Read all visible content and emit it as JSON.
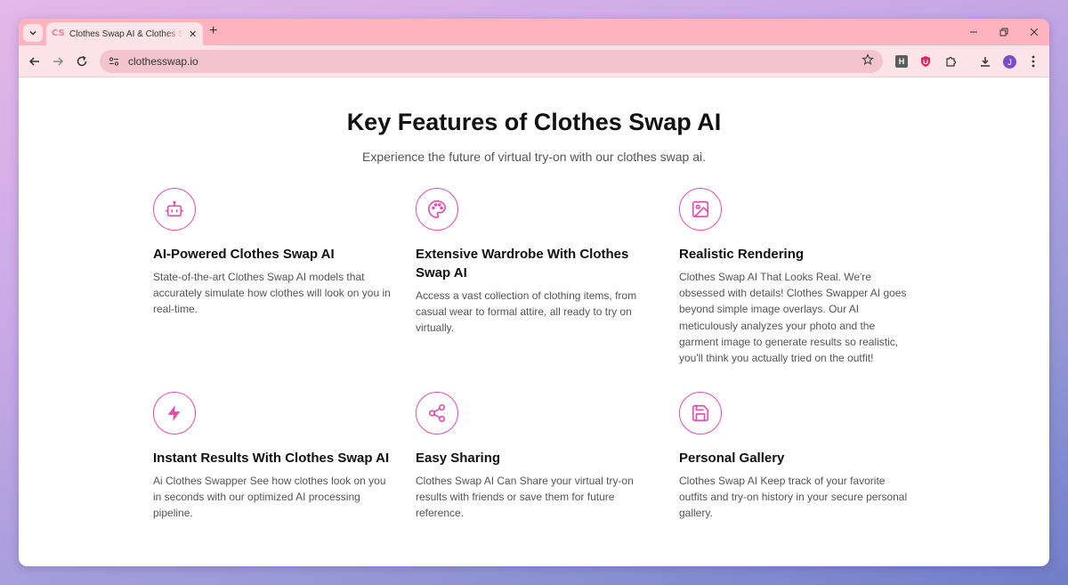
{
  "browser": {
    "tab_title": "Clothes Swap AI & Clothes Swap AI",
    "tab_favicon": "CS",
    "url": "clothesswap.io",
    "avatar_letter": "J",
    "ext_h_label": "H"
  },
  "page": {
    "heading": "Key Features of Clothes Swap AI",
    "subheading": "Experience the future of virtual try-on with our clothes swap ai.",
    "features": [
      {
        "icon": "robot-icon",
        "title": "AI-Powered Clothes Swap AI",
        "description": "State-of-the-art Clothes Swap AI models that accurately simulate how clothes will look on you in real-time."
      },
      {
        "icon": "palette-icon",
        "title": "Extensive Wardrobe With Clothes Swap AI",
        "description": "Access a vast collection of clothing items, from casual wear to formal attire, all ready to try on virtually."
      },
      {
        "icon": "image-icon",
        "title": "Realistic Rendering",
        "description": "Clothes Swap AI That Looks Real. We're obsessed with details! Clothes Swapper AI goes beyond simple image overlays. Our AI meticulously analyzes your photo and the garment image to generate results so realistic, you'll think you actually tried on the outfit!"
      },
      {
        "icon": "lightning-icon",
        "title": "Instant Results With Clothes Swap AI",
        "description": "Ai Clothes Swapper See how clothes look on you in seconds with our optimized AI processing pipeline."
      },
      {
        "icon": "share-icon",
        "title": "Easy Sharing",
        "description": "Clothes Swap AI Can Share your virtual try-on results with friends or save them for future reference."
      },
      {
        "icon": "save-icon",
        "title": "Personal Gallery",
        "description": "Clothes Swap AI Keep track of your favorite outfits and try-on history in your secure personal gallery."
      }
    ]
  },
  "colors": {
    "accent": "#e44db0",
    "tabbar": "#ffb3bf",
    "toolbar": "#fde4e9"
  }
}
